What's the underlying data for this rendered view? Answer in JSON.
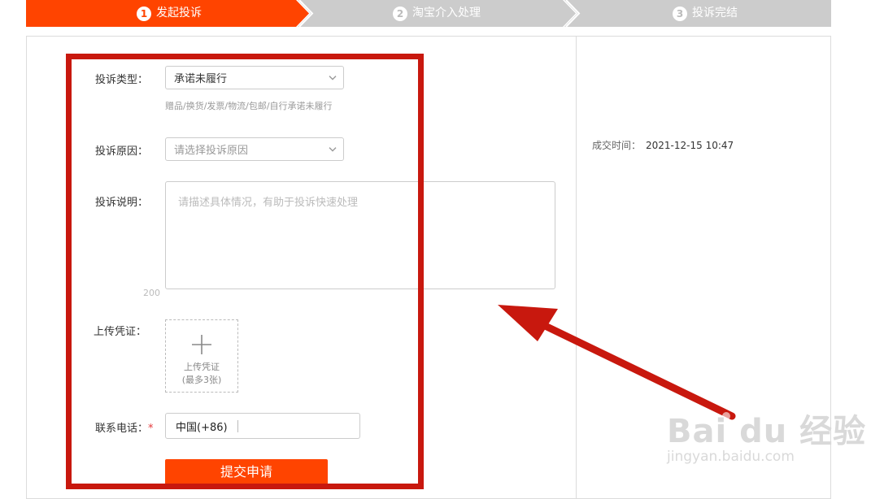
{
  "steps": [
    {
      "num": "1",
      "label": "发起投诉",
      "active": true
    },
    {
      "num": "2",
      "label": "淘宝介入处理",
      "active": false
    },
    {
      "num": "3",
      "label": "投诉完结",
      "active": false
    }
  ],
  "colors": {
    "accent": "#ff4400",
    "step_inactive": "#cccccc",
    "highlight": "#c8180e"
  },
  "form": {
    "type_label": "投诉类型：",
    "type_value": "承诺未履行",
    "type_hint": "赠品/换货/发票/物流/包邮/自行承诺未履行",
    "reason_label": "投诉原因：",
    "reason_placeholder": "请选择投诉原因",
    "desc_label": "投诉说明：",
    "desc_placeholder": "请描述具体情况，有助于投诉快速处理",
    "desc_counter": "200",
    "upload_label": "上传凭证：",
    "upload_button_text": "上传凭证",
    "upload_button_note": "(最多3张)",
    "phone_label": "联系电话：",
    "phone_required_mark": "*",
    "phone_value": "中国(+86)",
    "submit_label": "提交申请"
  },
  "sidebar": {
    "deal_time_label": "成交时间：",
    "deal_time_value": "2021-12-15 10:47"
  },
  "watermark": {
    "main": "Bai du 经验",
    "url": "jingyan.baidu.com"
  }
}
